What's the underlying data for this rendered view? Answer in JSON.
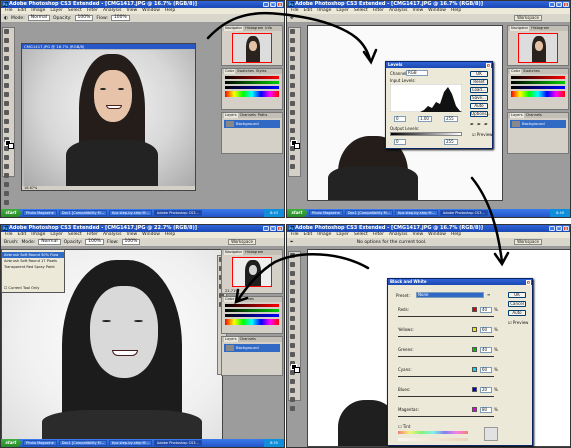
{
  "panels": [
    {
      "title": "Adobe Photoshop CS3 Extended - [CMG1417.JPG @ 16.7% (RGB/8)]",
      "menu": [
        "File",
        "Edit",
        "Image",
        "Layer",
        "Select",
        "Filter",
        "Analysis",
        "View",
        "Window",
        "Help"
      ],
      "options": [
        "Mode:",
        "Normal",
        "Opacity:",
        "100%",
        "Flow:",
        "100%"
      ],
      "doc_title": "CMG1417.JPG @ 16.7% (RGB/8)",
      "status": "16.67%",
      "palette_tabs": [
        "Navigator",
        "Histogram",
        "Info"
      ],
      "layers_tabs": [
        "Layers",
        "Channels",
        "Paths"
      ],
      "layer_name": "Background",
      "taskbar": {
        "start": "start",
        "tasks": [
          "Photo Magazine",
          "Doc1 [Compatibility M...",
          "tips step-by-step M...",
          "Adobe Photoshop CS3..."
        ],
        "clock": "8:43"
      }
    },
    {
      "title": "Adobe Photoshop CS3 Extended - [CMG1417.JPG @ 16.7% (RGB/8)]",
      "menu": [
        "File",
        "Edit",
        "Image",
        "Layer",
        "Select",
        "Filter",
        "Analysis",
        "View",
        "Window",
        "Help"
      ],
      "workspace": "Workspace",
      "dialog": {
        "title": "Levels",
        "channel_label": "Channel:",
        "channel_value": "RGB",
        "input_label": "Input Levels:",
        "input_values": [
          "0",
          "1.00",
          "255"
        ],
        "output_label": "Output Levels:",
        "output_values": [
          "0",
          "255"
        ],
        "buttons": [
          "OK",
          "Reset",
          "Load...",
          "Save...",
          "Auto",
          "Options..."
        ],
        "preview": "Preview"
      },
      "layer_name": "Background",
      "taskbar": {
        "start": "start",
        "tasks": [
          "Photo Magazine",
          "Doc1 [Compatibility M...",
          "tips step-by-step M...",
          "Adobe Photoshop CS3..."
        ],
        "clock": "8:49"
      }
    },
    {
      "title": "Adobe Photoshop CS3 Extended - [CMG1417.JPG @ 22.7% (RGB/8)]",
      "menu": [
        "File",
        "Edit",
        "Image",
        "Layer",
        "Select",
        "Filter",
        "Analysis",
        "View",
        "Window",
        "Help"
      ],
      "options": [
        "Brush:",
        "Mode:",
        "Normal",
        "Opacity:",
        "100%",
        "Flow:",
        "100%"
      ],
      "workspace": "Workspace",
      "tool_presets": [
        "Airbrush Soft Round 50% Flow",
        "Airbrush Soft Round 17 Pixels",
        "Transparent Red Spray Paint"
      ],
      "current_tool_only": "Current Tool Only",
      "nav_zoom": "22.71%",
      "layer_name": "Background",
      "taskbar": {
        "start": "start",
        "tasks": [
          "Photo Magazine",
          "Doc1 [Compatibility M...",
          "tips step-by-step M...",
          "Adobe Photoshop CS3..."
        ],
        "clock": "8:55"
      }
    },
    {
      "title": "Adobe Photoshop CS3 Extended - [CMG1417.JPG @ 16.7% (RGB/8)]",
      "menu": [
        "File",
        "Edit",
        "Image",
        "Layer",
        "Select",
        "Filter",
        "Analysis",
        "View",
        "Window",
        "Help"
      ],
      "options_text": "No options for the current tool.",
      "workspace": "Workspace",
      "dialog": {
        "title": "Black and White",
        "preset_label": "Preset:",
        "preset_value": "None",
        "channels": [
          {
            "name": "Reds:",
            "value": "40",
            "color": "#e00000"
          },
          {
            "name": "Yellows:",
            "value": "60",
            "color": "#f0e000"
          },
          {
            "name": "Greens:",
            "value": "40",
            "color": "#00c000"
          },
          {
            "name": "Cyans:",
            "value": "60",
            "color": "#00d8e8"
          },
          {
            "name": "Blues:",
            "value": "20",
            "color": "#0000d0"
          },
          {
            "name": "Magentas:",
            "value": "80",
            "color": "#e000e0"
          }
        ],
        "unit": "%",
        "tint": "Tint",
        "buttons": [
          "OK",
          "Cancel",
          "Auto"
        ],
        "preview": "Preview"
      }
    }
  ]
}
